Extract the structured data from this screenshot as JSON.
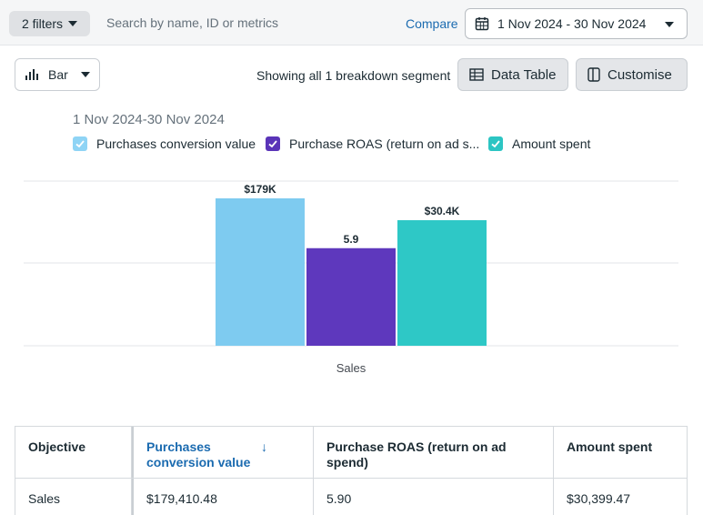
{
  "topbar": {
    "filters_label": "2 filters",
    "search_placeholder": "Search by name, ID or metrics",
    "compare_label": "Compare",
    "date_range": "1 Nov 2024 - 30 Nov 2024"
  },
  "toolbar": {
    "chart_type": "Bar",
    "segment_text": "Showing all 1 breakdown segment",
    "data_table_label": "Data Table",
    "customise_label": "Customise"
  },
  "chart_data": {
    "type": "bar",
    "title": "1 Nov 2024-30 Nov 2024",
    "categories": [
      "Sales"
    ],
    "series": [
      {
        "name": "Purchases conversion value",
        "values": [
          179410.48
        ],
        "label": "$179K",
        "color": "#7ecbf0",
        "check": "#8fd4f5"
      },
      {
        "name": "Purchase ROAS (return on ad s...",
        "values": [
          5.9
        ],
        "label": "5.9",
        "color": "#5e38bd",
        "check": "#5a34b8"
      },
      {
        "name": "Amount spent",
        "values": [
          30399.47
        ],
        "label": "$30.4K",
        "color": "#2ec8c6",
        "check": "#2cc5c3"
      }
    ],
    "grid": true,
    "legend_position": "top-left"
  },
  "table": {
    "headers": [
      "Objective",
      "Purchases conversion value",
      "Purchase ROAS (return on ad spend)",
      "Amount spent"
    ],
    "sort_arrow": "↓",
    "rows": [
      [
        "Sales",
        "$179,410.48",
        "5.90",
        "$30,399.47"
      ]
    ]
  }
}
